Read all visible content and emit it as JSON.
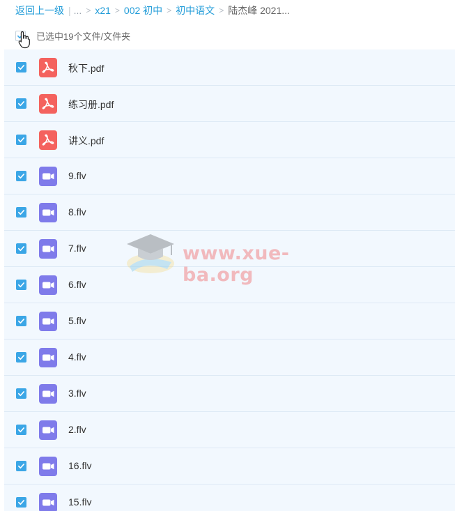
{
  "breadcrumb": {
    "back": "返回上一级",
    "ellipsis": "...",
    "items": [
      "x21",
      "002 初中",
      "初中语文"
    ],
    "current": "陆杰峰 2021..."
  },
  "selection": {
    "text": "已选中19个文件/文件夹"
  },
  "files": [
    {
      "name": "秋下.pdf",
      "type": "pdf",
      "checked": true
    },
    {
      "name": "练习册.pdf",
      "type": "pdf",
      "checked": true
    },
    {
      "name": "讲义.pdf",
      "type": "pdf",
      "checked": true
    },
    {
      "name": "9.flv",
      "type": "video",
      "checked": true
    },
    {
      "name": "8.flv",
      "type": "video",
      "checked": true
    },
    {
      "name": "7.flv",
      "type": "video",
      "checked": true
    },
    {
      "name": "6.flv",
      "type": "video",
      "checked": true
    },
    {
      "name": "5.flv",
      "type": "video",
      "checked": true
    },
    {
      "name": "4.flv",
      "type": "video",
      "checked": true
    },
    {
      "name": "3.flv",
      "type": "video",
      "checked": true
    },
    {
      "name": "2.flv",
      "type": "video",
      "checked": true
    },
    {
      "name": "16.flv",
      "type": "video",
      "checked": true
    },
    {
      "name": "15.flv",
      "type": "video",
      "checked": true
    }
  ],
  "watermark": {
    "text": "www.xue-ba.org"
  },
  "icons": {
    "pdf": "pdf-file-icon",
    "video": "video-file-icon",
    "check": "checkmark-icon",
    "cursor": "hand-pointer-icon"
  },
  "colors": {
    "link": "#1f9bd8",
    "checkbox": "#3ba6e6",
    "pdf": "#f4625e",
    "video": "#7f7bea",
    "list_bg": "#f2f8fe"
  }
}
